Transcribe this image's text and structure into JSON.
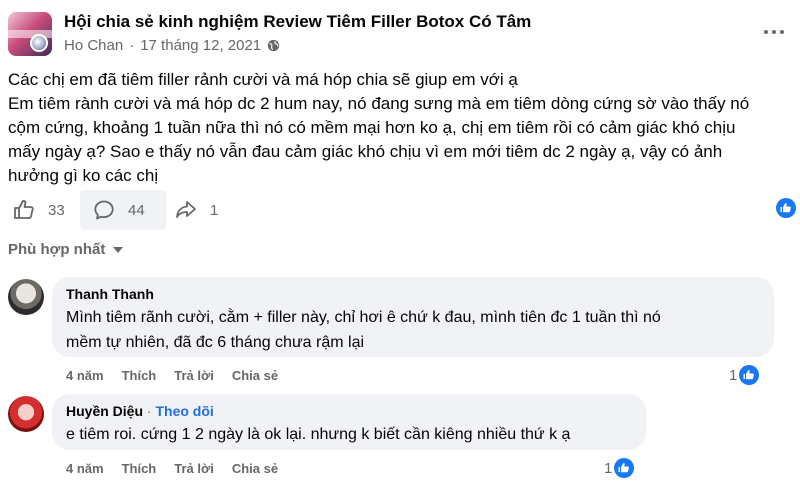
{
  "post": {
    "group_name": "Hội chia sẻ kinh nghiệm Review Tiêm Filler Botox Có Tâm",
    "author": "Ho Chan",
    "separator": "·",
    "date": "17 tháng 12, 2021",
    "privacy_icon": "globe-icon",
    "text": "Các chị em đã tiêm filler rảnh cười và má hóp chia sẽ giup em với ạ\nEm tiêm rành cười và má hóp dc 2 hum nay, nó đang sưng mà em tiêm dòng cứng sờ vào thấy nó cộm cứng, khoảng 1 tuần nữa thì nó có mềm mại hơn ko ạ, chị em tiêm rồi có cảm giác khó chịu mấy ngày ạ? Sao e thấy nó vẫn đau cảm giác khó chịu vì em mới tiêm dc 2 ngày ạ, vậy có ảnh hưởng gì ko các chị",
    "text_lines": [
      "Các chị em đã tiêm filler rảnh cười và má hóp chia sẽ giup em với ạ",
      "Em tiêm rành cười và má hóp dc 2 hum nay, nó đang sưng mà em tiêm dòng cứng sờ vào thấy nó",
      "cộm cứng, khoảng 1 tuần nữa thì nó có mềm mại hơn ko ạ, chị em tiêm rồi có cảm giác khó chịu",
      "mấy ngày ạ? Sao e thấy nó vẫn đau cảm giác khó chịu vì em mới tiêm dc 2 ngày ạ, vậy có ảnh",
      "hưởng gì ko các chị"
    ],
    "likes": "33",
    "comments": "44",
    "shares": "1"
  },
  "sort_label": "Phù hợp nhất",
  "comments": [
    {
      "author": "Thanh Thanh",
      "follow": "",
      "lines": [
        "Mình tiêm rãnh cười, cằm + filler này, chỉ hơi ê chứ k đau, mình tiên đc 1 tuần thì nó",
        "mềm tự nhiên, đã đc 6 tháng chưa rậm lại"
      ],
      "time": "4 năm",
      "like_label": "Thích",
      "reply_label": "Trả lời",
      "share_label": "Chia sẻ",
      "reactions": "1"
    },
    {
      "author": "Huyền Diệu",
      "separator": "·",
      "follow": "Theo dõi",
      "lines": [
        "e tiêm roi. cứng 1 2 ngày là ok lại. nhưng k biết cần kiêng nhiều thứ k ạ"
      ],
      "time": "4 năm",
      "like_label": "Thích",
      "reply_label": "Trả lời",
      "share_label": "Chia sẻ",
      "reactions": "1"
    }
  ],
  "colors": {
    "text": "#050505",
    "secondary": "#65676b",
    "bubble": "#f0f2f5",
    "link": "#216fdb",
    "like_blue": "#1877f2"
  }
}
